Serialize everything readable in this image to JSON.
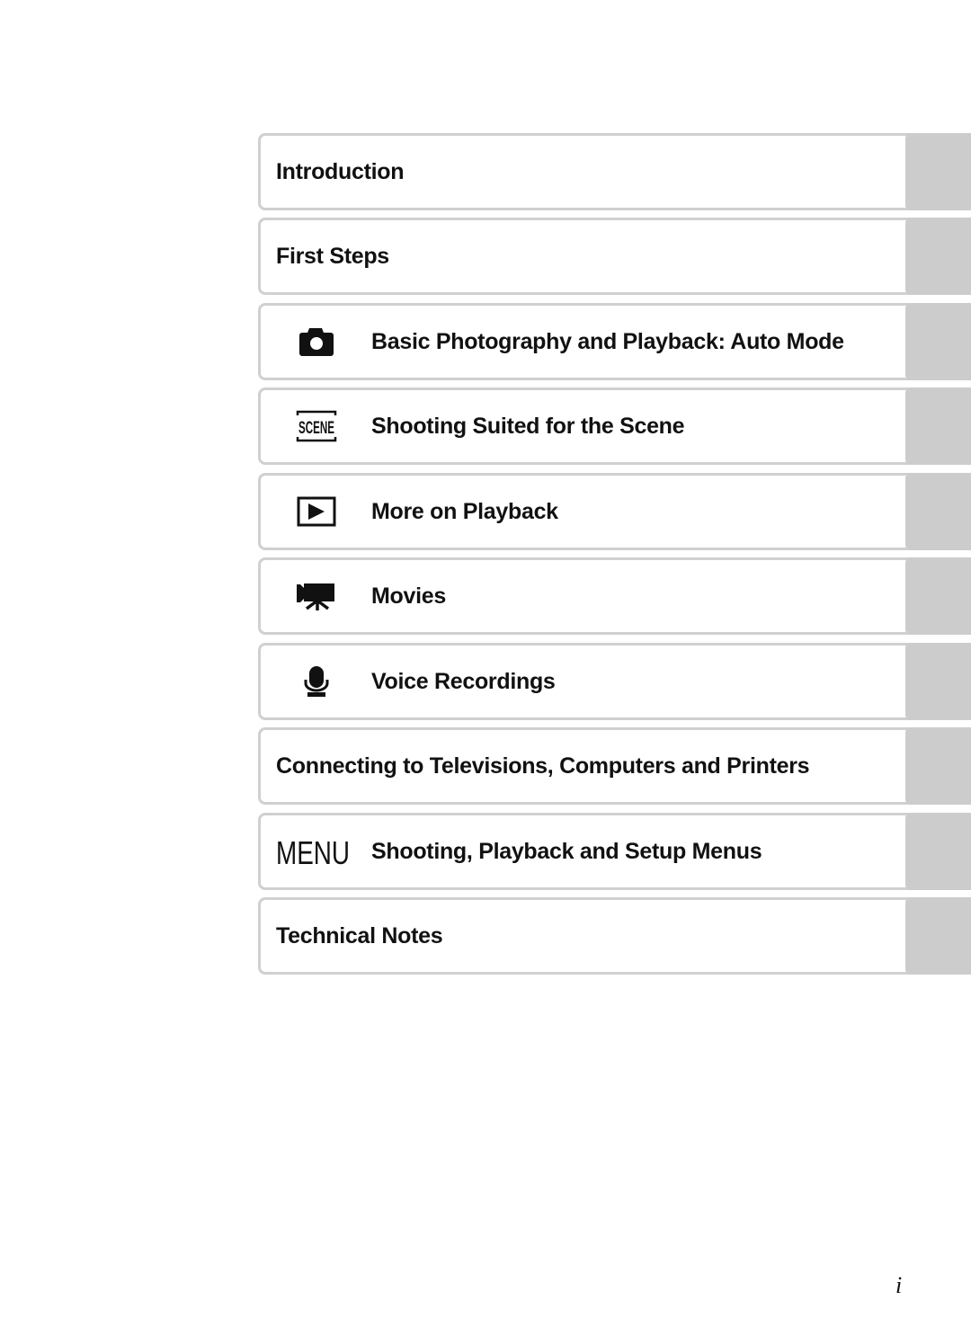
{
  "toc": {
    "items": [
      {
        "label": "Introduction",
        "icon": null
      },
      {
        "label": "First Steps",
        "icon": null
      },
      {
        "label": "Basic Photography and Playback: Auto Mode",
        "icon": "camera-icon"
      },
      {
        "label": "Shooting Suited for the Scene",
        "icon": "scene-icon"
      },
      {
        "label": "More on Playback",
        "icon": "playback-icon"
      },
      {
        "label": "Movies",
        "icon": "movie-camera-icon"
      },
      {
        "label": "Voice Recordings",
        "icon": "microphone-icon"
      },
      {
        "label": "Connecting to Televisions, Computers and Printers",
        "icon": null
      },
      {
        "label": "Shooting, Playback and Setup Menus",
        "icon": "menu-icon"
      },
      {
        "label": "Technical Notes",
        "icon": null
      }
    ],
    "icon_texts": {
      "scene": "SCENE",
      "menu": "MENU"
    }
  },
  "colors": {
    "tab": "#cccccc",
    "border": "#d0d0d0",
    "text": "#111111"
  },
  "page_number": "i"
}
